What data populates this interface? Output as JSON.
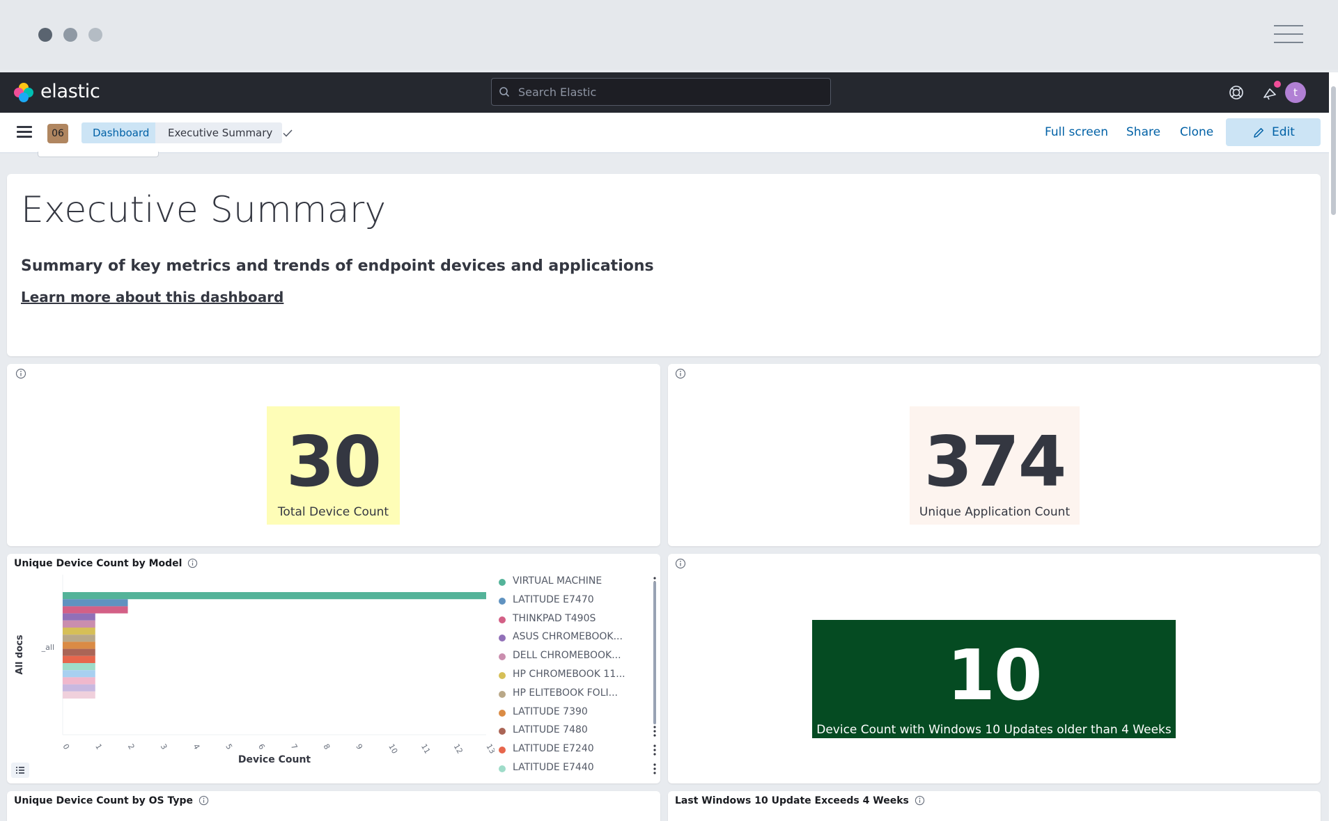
{
  "brand": {
    "name": "elastic"
  },
  "search": {
    "placeholder": "Search Elastic"
  },
  "header": {
    "avatar_initial": "t"
  },
  "nav": {
    "space_badge": "06",
    "breadcrumbs": [
      "Dashboard",
      "Executive Summary"
    ],
    "actions": {
      "full_screen": "Full screen",
      "share": "Share",
      "clone": "Clone",
      "edit": "Edit"
    }
  },
  "markdown_panel": {
    "title": "Executive Summary",
    "subtitle": "Summary of key metrics and trends of endpoint devices and applications",
    "link": "Learn more about this dashboard"
  },
  "metrics": {
    "total_devices": {
      "value": "30",
      "label": "Total Device Count",
      "bg_color": "#fefdb7"
    },
    "unique_apps": {
      "value": "374",
      "label": "Unique Application Count",
      "bg_color": "#fdf4ef"
    },
    "win10_old": {
      "value": "10",
      "label": "Device Count with Windows 10 Updates older than 4 Weeks",
      "bg_color": "#054b22"
    }
  },
  "device_by_model": {
    "title": "Unique Device Count by Model",
    "legend": [
      {
        "label": "VIRTUAL MACHINE",
        "color": "#54b399"
      },
      {
        "label": "LATITUDE E7470",
        "color": "#6092c0"
      },
      {
        "label": "THINKPAD T490S",
        "color": "#d36086"
      },
      {
        "label": "ASUS CHROMEBOOK...",
        "color": "#9170b8"
      },
      {
        "label": "DELL CHROMEBOOK...",
        "color": "#ca8eae"
      },
      {
        "label": "HP CHROMEBOOK 11...",
        "color": "#d6bf57"
      },
      {
        "label": "HP ELITEBOOK FOLI...",
        "color": "#b9a888"
      },
      {
        "label": "LATITUDE 7390",
        "color": "#da8b45"
      },
      {
        "label": "LATITUDE 7480",
        "color": "#aa6556"
      },
      {
        "label": "LATITUDE E7240",
        "color": "#e7664c"
      },
      {
        "label": "LATITUDE E7440",
        "color": "#9fdcc9"
      }
    ]
  },
  "chart_data": {
    "type": "bar",
    "orientation": "horizontal",
    "xlabel": "Device Count",
    "ylabel": "All docs",
    "y_category": "_all",
    "xlim": [
      0,
      13
    ],
    "x_ticks": [
      "0",
      "1",
      "2",
      "3",
      "4",
      "5",
      "6",
      "7",
      "8",
      "9",
      "10",
      "11",
      "12",
      "13"
    ],
    "series": [
      {
        "name": "VIRTUAL MACHINE",
        "value": 13,
        "color": "#54b399"
      },
      {
        "name": "LATITUDE E7470",
        "value": 2,
        "color": "#6092c0"
      },
      {
        "name": "THINKPAD T490S",
        "value": 2,
        "color": "#d36086"
      },
      {
        "name": "ASUS CHROMEBOOK...",
        "value": 1,
        "color": "#9170b8"
      },
      {
        "name": "DELL CHROMEBOOK...",
        "value": 1,
        "color": "#ca8eae"
      },
      {
        "name": "HP CHROMEBOOK 11...",
        "value": 1,
        "color": "#d6bf57"
      },
      {
        "name": "HP ELITEBOOK FOLI...",
        "value": 1,
        "color": "#b9a888"
      },
      {
        "name": "LATITUDE 7390",
        "value": 1,
        "color": "#da8b45"
      },
      {
        "name": "LATITUDE 7480",
        "value": 1,
        "color": "#aa6556"
      },
      {
        "name": "LATITUDE E7240",
        "value": 1,
        "color": "#e7664c"
      },
      {
        "name": "LATITUDE E7440",
        "value": 1,
        "color": "#9fdcc9"
      },
      {
        "value": 1,
        "color": "#a8d0f0"
      },
      {
        "value": 1,
        "color": "#f0b8cc"
      },
      {
        "value": 1,
        "color": "#c8b8e0"
      },
      {
        "value": 1,
        "color": "#f0d0dc"
      }
    ]
  },
  "bottom_panels": {
    "os_type_title": "Unique Device Count by OS Type",
    "win10_update_title": "Last Windows 10 Update Exceeds 4 Weeks"
  }
}
